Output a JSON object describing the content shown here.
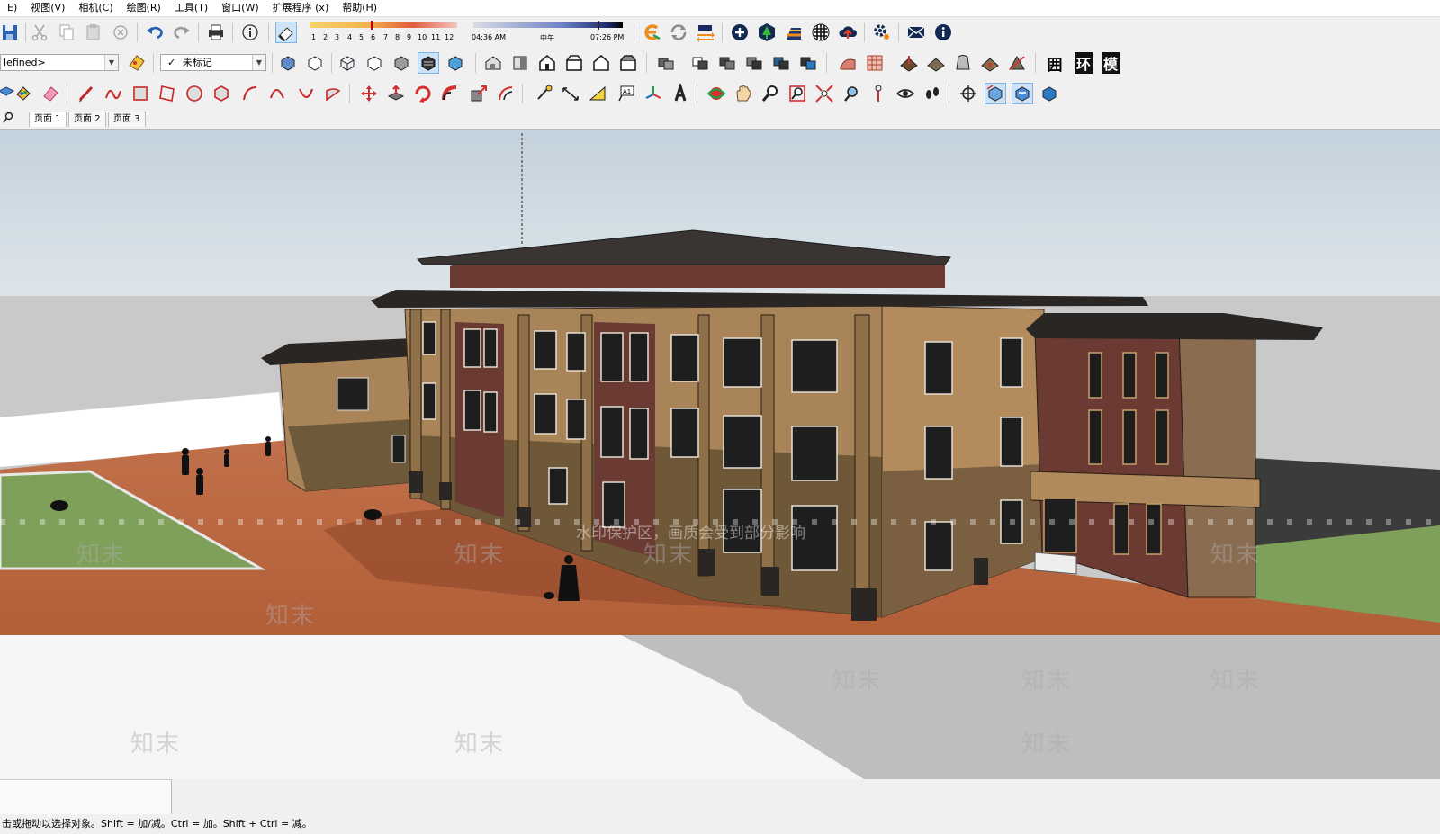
{
  "menu": [
    "E)",
    "视图(V)",
    "相机(C)",
    "绘图(R)",
    "工具(T)",
    "窗口(W)",
    "扩展程序 (x)",
    "帮助(H)"
  ],
  "shadow": {
    "months": [
      "1",
      "2",
      "3",
      "4",
      "5",
      "6",
      "7",
      "8",
      "9",
      "10",
      "11",
      "12"
    ],
    "time_start": "04:36 AM",
    "time_mid": "中午",
    "time_end": "07:26 PM"
  },
  "style_combo": {
    "value": "lefined>"
  },
  "tag_combo": {
    "check": "✓",
    "value": "未标记"
  },
  "text_buttons": [
    "囲",
    "环",
    "模"
  ],
  "scenes": [
    "页面 1",
    "页面 2",
    "页面 3"
  ],
  "viewport": {
    "watermark_text": "知末",
    "watermark_banner": "水印保护区，画质会受到部分影响"
  },
  "status": {
    "hint": "击或拖动以选择对象。Shift = 加/减。Ctrl = 加。Shift + Ctrl = 减。"
  },
  "colors": {
    "sky": "#cfd9e2",
    "plaza": "#b8663f",
    "grass": "#7fa05a",
    "wall": "#a88458",
    "brick": "#6a3a33",
    "roof": "#2a2624"
  }
}
